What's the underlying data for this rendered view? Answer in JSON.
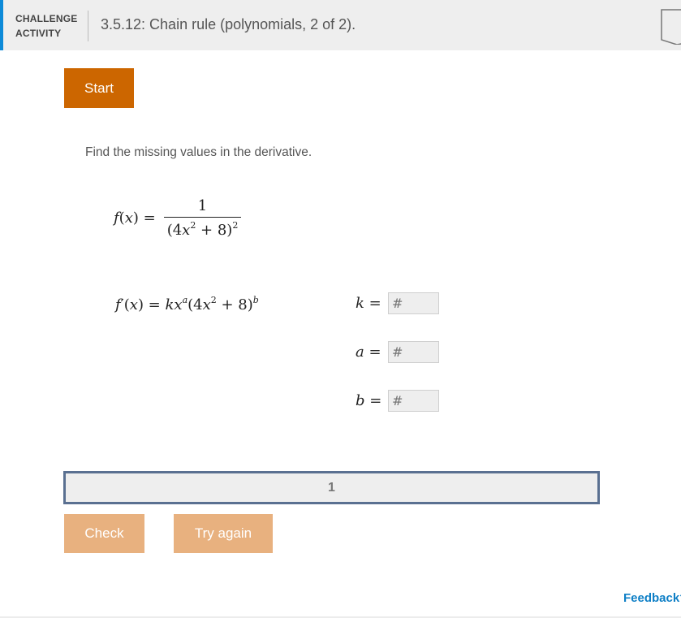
{
  "header": {
    "label_line1": "CHALLENGE",
    "label_line2": "ACTIVITY",
    "title": "3.5.12: Chain rule (polynomials, 2 of 2).",
    "accent_color": "#0d8ad8",
    "bookmark_icon": "bookmark-icon"
  },
  "start_button": {
    "label": "Start",
    "color": "#cc6600"
  },
  "prompt": "Find the missing values in the derivative.",
  "function": {
    "lhs": "f(x) =",
    "numerator": "1",
    "denominator_base": "(4x",
    "denominator_inner_exp": "2",
    "denominator_rest": " + 8)",
    "denominator_outer_exp": "2"
  },
  "derivative": {
    "lhs": "f′(x) = kx",
    "exp_a": "a",
    "middle": "(4x",
    "inner_exp": "2",
    "rest": " + 8)",
    "exp_b": "b"
  },
  "answers": [
    {
      "variable": "k",
      "equals": "=",
      "placeholder": "#",
      "value": ""
    },
    {
      "variable": "a",
      "equals": "=",
      "placeholder": "#",
      "value": ""
    },
    {
      "variable": "b",
      "equals": "=",
      "placeholder": "#",
      "value": ""
    }
  ],
  "progress": {
    "current_step": "1",
    "border_color": "#5a7091"
  },
  "buttons": {
    "check": "Check",
    "try_again": "Try again",
    "disabled_color": "#e8b17f"
  },
  "feedback_link": "Feedback?"
}
